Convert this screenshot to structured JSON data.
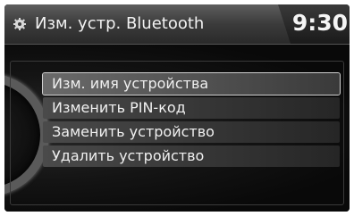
{
  "header": {
    "title": "Изм. устр. Bluetooth",
    "clock": "9:30",
    "icon": "gear-icon"
  },
  "menu": {
    "items": [
      {
        "label": "Изм. имя устройства",
        "selected": true
      },
      {
        "label": "Изменить PIN-код",
        "selected": false
      },
      {
        "label": "Заменить устройство",
        "selected": false
      },
      {
        "label": "Удалить устройство",
        "selected": false
      }
    ]
  },
  "colors": {
    "background": "#0b0b0b",
    "header": "#3b3b3b",
    "item": "#3a3a3a",
    "text": "#f0f0f0"
  }
}
